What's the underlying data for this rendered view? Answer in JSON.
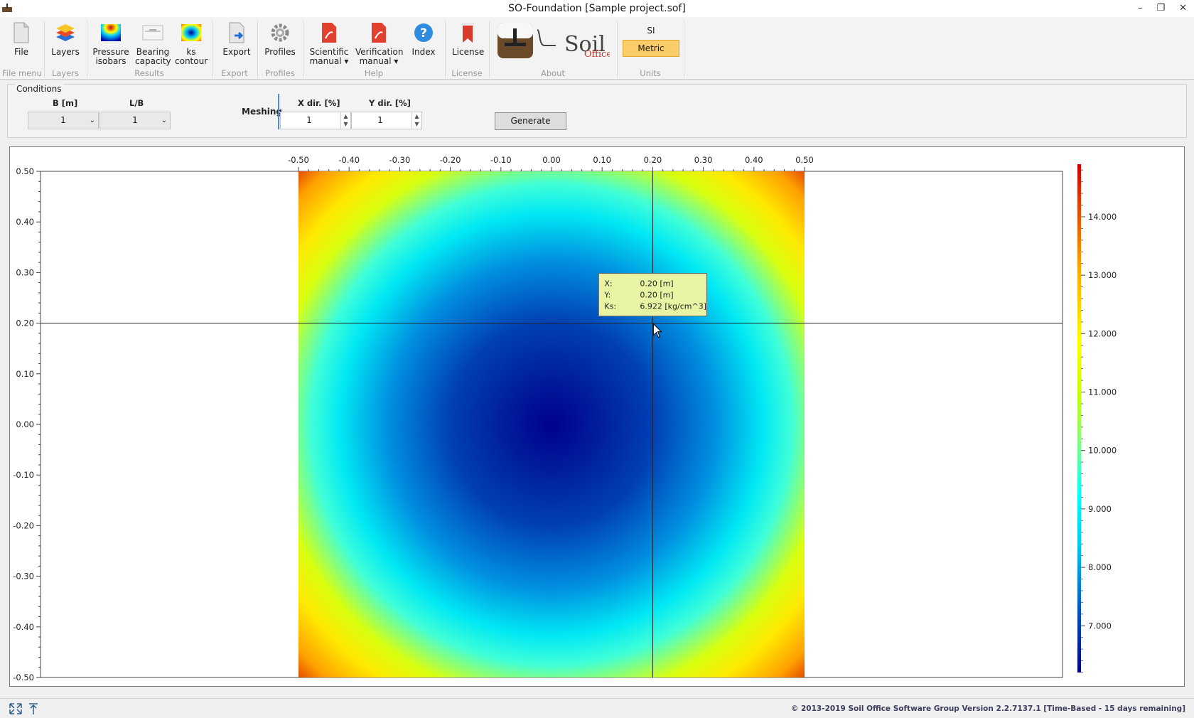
{
  "window": {
    "title": "SO-Foundation [Sample project.sof]",
    "minimize": "–",
    "restore": "❐",
    "close": "✕"
  },
  "ribbon": {
    "buttons": [
      {
        "label1": "File",
        "label2": "",
        "icon": "file-icon"
      },
      {
        "label1": "Layers",
        "label2": "",
        "icon": "layers-icon"
      },
      {
        "label1": "Pressure",
        "label2": "isobars",
        "icon": "pressure-isobars-icon"
      },
      {
        "label1": "Bearing",
        "label2": "capacity",
        "icon": "bearing-capacity-icon"
      },
      {
        "label1": "ks",
        "label2": "contour",
        "icon": "ks-contour-icon"
      },
      {
        "label1": "Export",
        "label2": "",
        "icon": "export-icon"
      },
      {
        "label1": "Profiles",
        "label2": "",
        "icon": "gear-icon"
      },
      {
        "label1": "Scientific",
        "label2": "manual ▾",
        "icon": "pdf-icon"
      },
      {
        "label1": "Verification",
        "label2": "manual ▾",
        "icon": "pdf-icon"
      },
      {
        "label1": "Index",
        "label2": "",
        "icon": "help-icon"
      },
      {
        "label1": "License",
        "label2": "",
        "icon": "bookmark-icon"
      }
    ],
    "groups": [
      "File menu",
      "Layers",
      "Results",
      "Export",
      "Profiles",
      "Help",
      "License",
      "About",
      "Units"
    ],
    "logo_text": "Soil",
    "logo_sub": "Office",
    "units": {
      "si": "SI",
      "metric": "Metric",
      "active_color": "#fbcd6a"
    }
  },
  "conditions": {
    "legend": "Conditions",
    "b_label": "B [m]",
    "b_value": "1",
    "lb_label": "L/B",
    "lb_value": "1",
    "meshing_label": "Meshing",
    "x_dir_label": "X dir. [%]",
    "x_dir_value": "1",
    "y_dir_label": "Y dir. [%]",
    "y_dir_value": "1",
    "generate_label": "Generate"
  },
  "chart_data": {
    "type": "heatmap",
    "title": "",
    "xlabel": "",
    "ylabel": "",
    "x_ticks": [
      "-0.50",
      "-0.40",
      "-0.30",
      "-0.20",
      "-0.10",
      "0.00",
      "0.10",
      "0.20",
      "0.30",
      "0.40",
      "0.50"
    ],
    "y_ticks": [
      "0.50",
      "0.40",
      "0.30",
      "0.20",
      "0.10",
      "0.00",
      "-0.10",
      "-0.20",
      "-0.30",
      "-0.40",
      "-0.50"
    ],
    "xlim": [
      -0.5,
      0.5
    ],
    "ylim": [
      -0.5,
      0.5
    ],
    "colorbar_ticks": [
      "14.000",
      "13.000",
      "12.000",
      "11.000",
      "10.000",
      "9.000",
      "8.000",
      "7.000"
    ],
    "colorbar_range": [
      6.2,
      14.9
    ],
    "field": "ks minimum at center (≈6.2), rising toward edges, maximum at corners (≈14.9)",
    "crosshair": {
      "x": 0.2,
      "y": 0.2
    },
    "tooltip": {
      "x_label": "X:",
      "x_value": "0.20 [m]",
      "y_label": "Y:",
      "y_value": "0.20 [m]",
      "ks_label": "Ks:",
      "ks_value": "6.922 [kg/cm^3]"
    },
    "colors": [
      "#00008c",
      "#0050c8",
      "#00c8f0",
      "#00ffff",
      "#c8ff00",
      "#ffff00",
      "#ffa000",
      "#d03000"
    ]
  },
  "status": {
    "copyright": "© 2013-2019  Soil Office Software Group    Version 2.2.7137.1 [Time-Based - 15 days remaining]"
  }
}
